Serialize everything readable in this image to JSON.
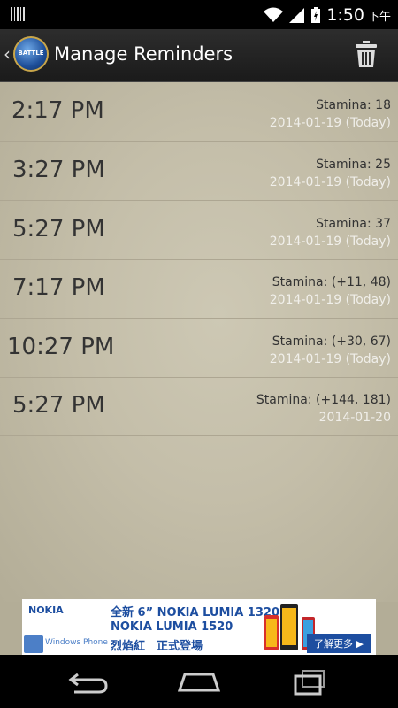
{
  "status_bar": {
    "time": "1:50",
    "ampm": "下午"
  },
  "action_bar": {
    "back_glyph": "‹",
    "logo_text": "BATTLE",
    "title": "Manage Reminders",
    "icons": {
      "app": "app-logo-icon",
      "delete": "trash-icon"
    }
  },
  "reminders": [
    {
      "time": "2:17 PM",
      "stamina": "Stamina: 18",
      "date": "2014-01-19 (Today)"
    },
    {
      "time": "3:27 PM",
      "stamina": "Stamina: 25",
      "date": "2014-01-19 (Today)"
    },
    {
      "time": "5:27 PM",
      "stamina": "Stamina: 37",
      "date": "2014-01-19 (Today)"
    },
    {
      "time": "7:17 PM",
      "stamina": "Stamina: (+11, 48)",
      "date": "2014-01-19 (Today)"
    },
    {
      "time": "10:27 PM",
      "stamina": "Stamina: (+30, 67)",
      "date": "2014-01-19 (Today)"
    },
    {
      "time": "5:27 PM",
      "stamina": "Stamina: (+144, 181)",
      "date": "2014-01-20"
    }
  ],
  "ad": {
    "brand": "NOKIA",
    "line1": "全新 6” NOKIA LUMIA 1320",
    "line2": "NOKIA LUMIA 1520",
    "line3": "烈焰紅　正式登場",
    "windows_phone": "Windows Phone",
    "cta": "了解更多 ▶"
  },
  "colors": {
    "ad_blue": "#1d4ea0",
    "background": "#c4bea9"
  }
}
